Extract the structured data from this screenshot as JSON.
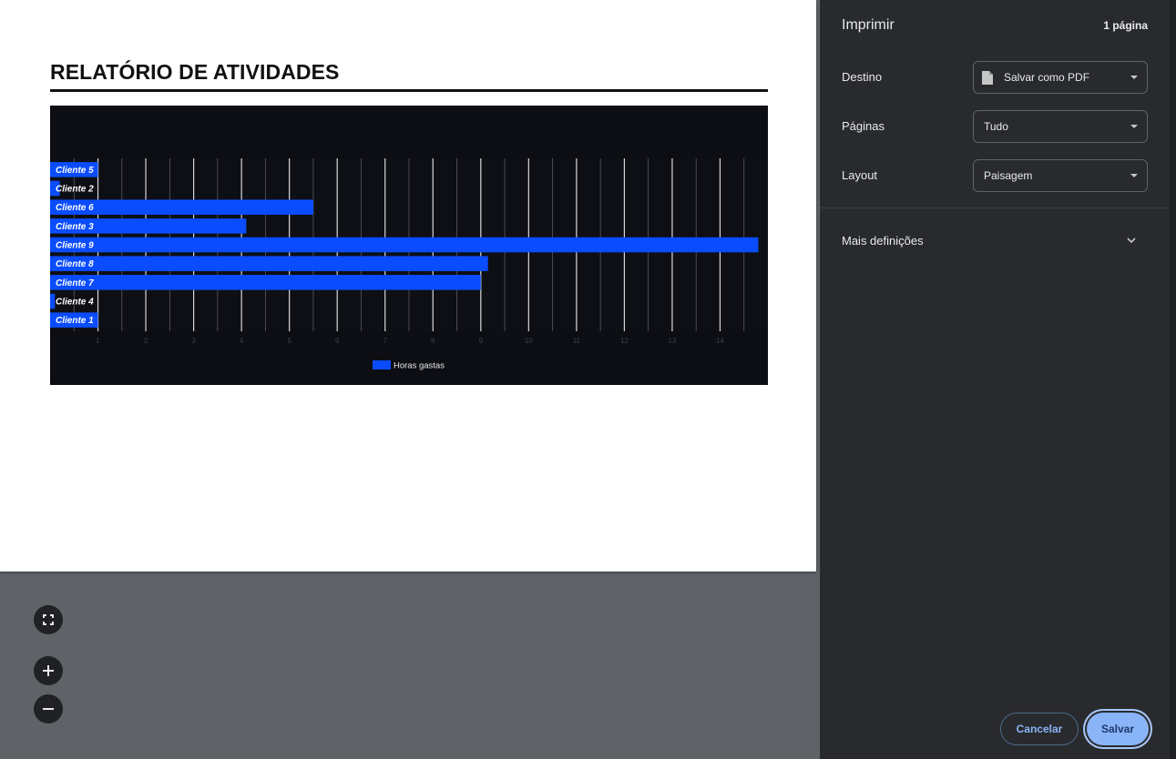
{
  "report": {
    "title": "RELATÓRIO DE ATIVIDADES"
  },
  "chart_data": {
    "type": "bar",
    "orientation": "horizontal",
    "categories": [
      "Cliente 5",
      "Cliente 2",
      "Cliente 6",
      "Cliente 3",
      "Cliente 9",
      "Cliente 8",
      "Cliente 7",
      "Cliente 4",
      "Cliente 1"
    ],
    "series": [
      {
        "name": "Horas gastas",
        "values": [
          1,
          0.2,
          5.5,
          4.1,
          14.8,
          9.15,
          9.0,
          0.1,
          1
        ],
        "color": "#0a4cff"
      }
    ],
    "x_ticks": [
      "1",
      "2",
      "3",
      "4",
      "5",
      "6",
      "7",
      "8",
      "9",
      "10",
      "11",
      "12",
      "13",
      "14"
    ],
    "xlim": [
      0,
      15
    ],
    "grid": true,
    "legend": "bottom-center",
    "background": "#0d0e14"
  },
  "zoom_controls": {
    "fit_icon": "fit-to-page-icon",
    "zoom_in_icon": "plus-icon",
    "zoom_out_icon": "minus-icon"
  },
  "sidebar": {
    "title": "Imprimir",
    "page_count": "1 página",
    "destination": {
      "label": "Destino",
      "value": "Salvar como PDF",
      "icon": "file-icon"
    },
    "pages": {
      "label": "Páginas",
      "value": "Tudo"
    },
    "layout": {
      "label": "Layout",
      "value": "Paisagem"
    },
    "more_settings": "Mais definições",
    "cancel_label": "Cancelar",
    "save_label": "Salvar",
    "accent": "#8ab4f8"
  }
}
